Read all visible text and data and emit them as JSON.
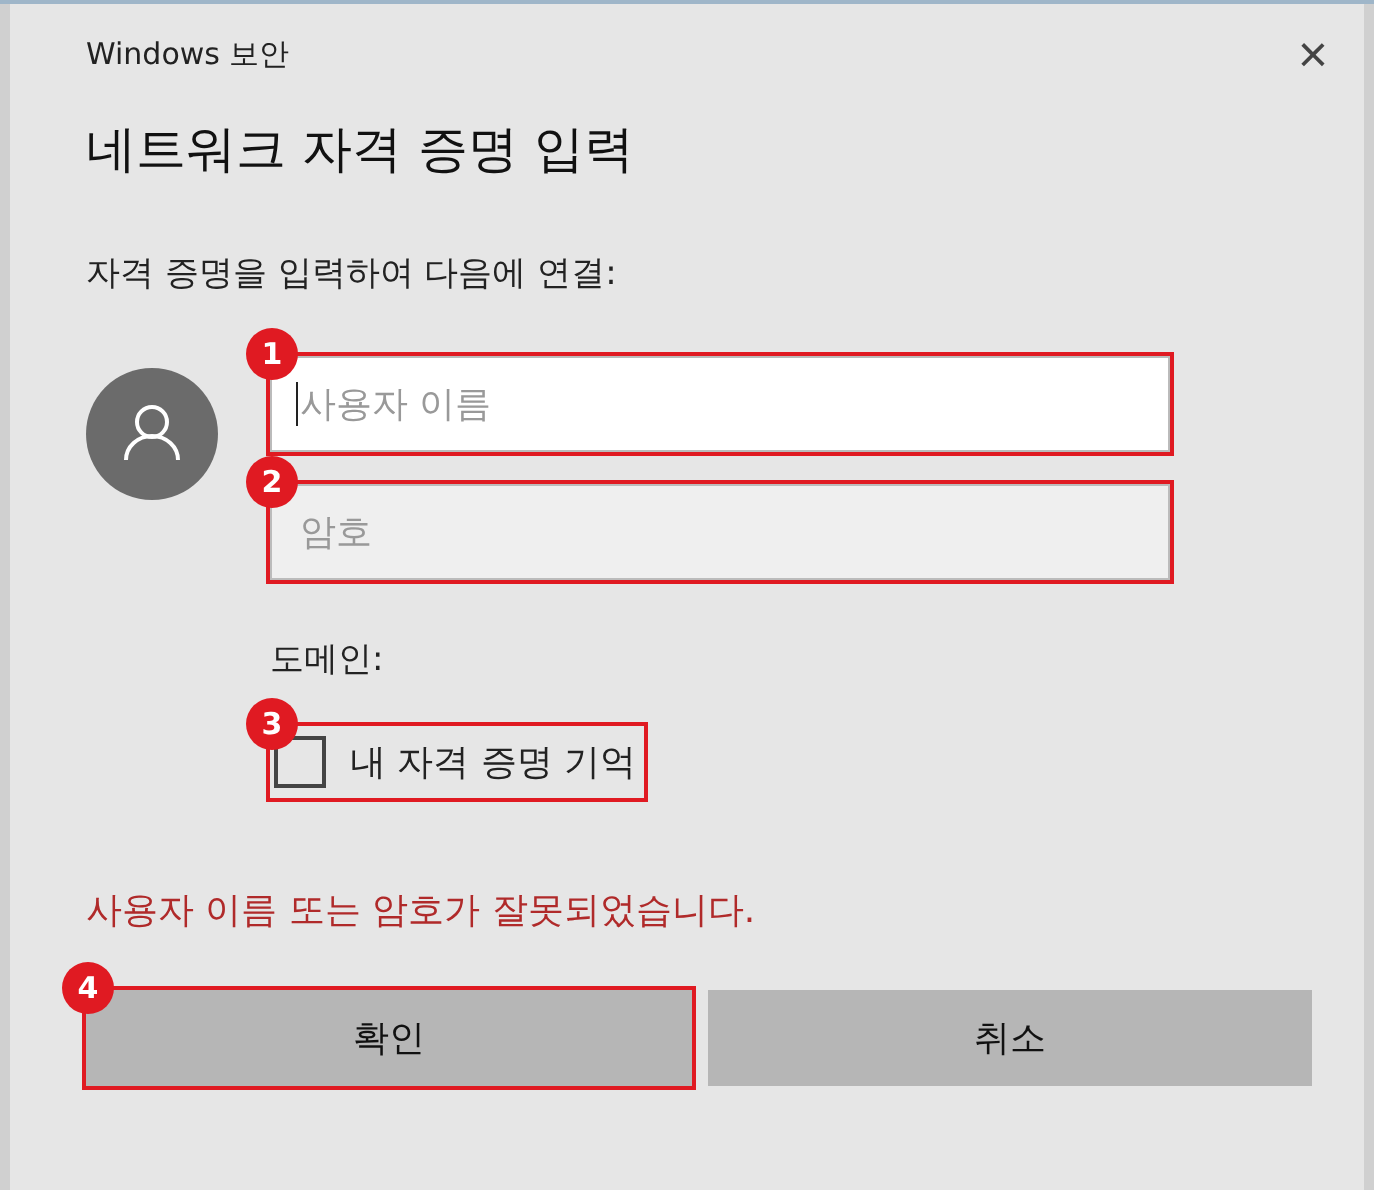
{
  "window": {
    "title": "Windows 보안",
    "close_icon": "×"
  },
  "heading": "네트워크 자격 증명 입력",
  "prompt": "자격 증명을 입력하여 다음에 연결:",
  "fields": [
    {
      "placeholder": "사용자 이름",
      "focused": true,
      "callout": "1"
    },
    {
      "placeholder": "암호",
      "focused": false,
      "callout": "2"
    }
  ],
  "domain_label": "도메인:",
  "remember": {
    "label": "내 자격 증명 기억",
    "checked": false,
    "callout": "3"
  },
  "error": "사용자 이름 또는 암호가 잘못되었습니다.",
  "buttons": [
    {
      "label": "확인",
      "callout": "4"
    },
    {
      "label": "취소"
    }
  ]
}
